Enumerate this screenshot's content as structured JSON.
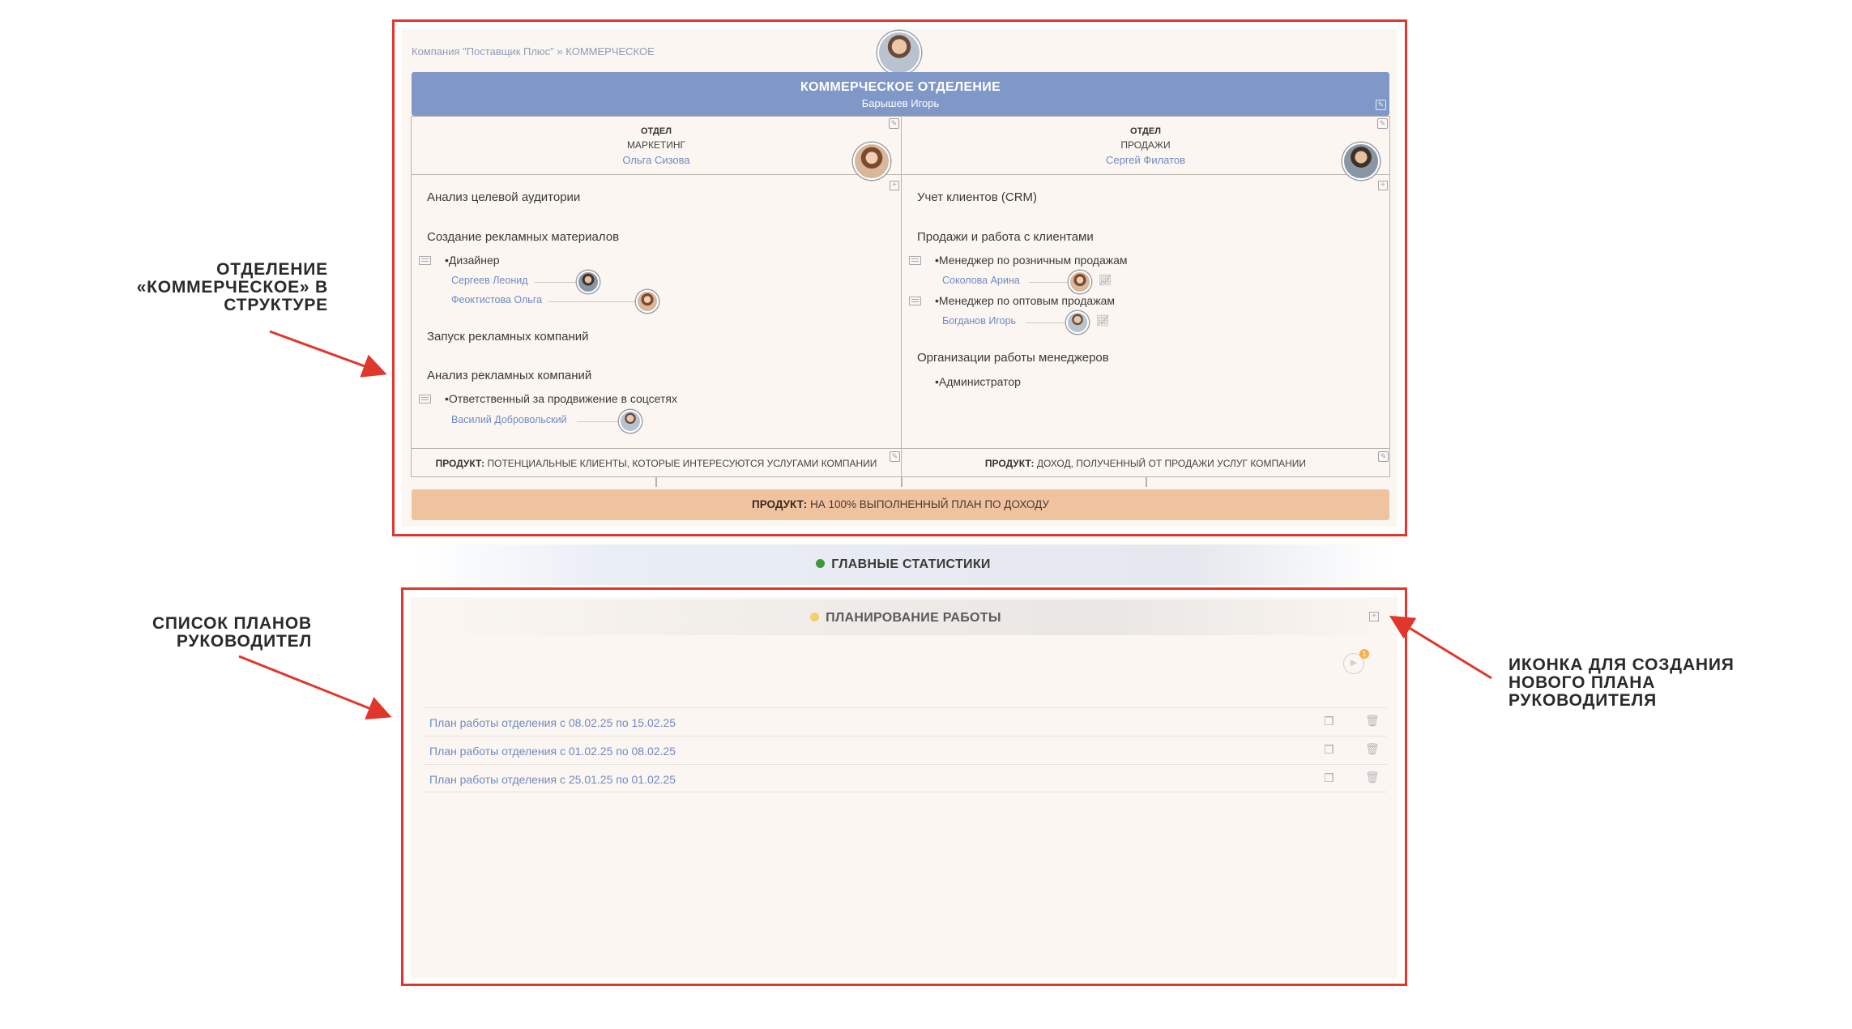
{
  "breadcrumb": {
    "company": "Компания \"Поставщик Плюс\"",
    "separator": "»",
    "current": "КОММЕРЧЕСКОЕ"
  },
  "division": {
    "title": "КОММЕРЧЕСКОЕ ОТДЕЛЕНИЕ",
    "head": "Барышев Игорь"
  },
  "departments": [
    {
      "type": "ОТДЕЛ",
      "name": "МАРКЕТИНГ",
      "head": "Ольга Сизова",
      "functions": [
        "Анализ целевой аудитории",
        "Создание рекламных материалов",
        "Запуск рекламных компаний",
        "Анализ рекламных компаний"
      ],
      "roles": [
        {
          "title": "Дизайнер",
          "people": [
            "Сергеев Леонид",
            "Феоктистова Ольга"
          ]
        },
        {
          "title": "Ответственный за продвижение в соцсетях",
          "people": [
            "Василий Добровольский"
          ]
        }
      ],
      "product_label": "ПРОДУКТ:",
      "product": "ПОТЕНЦИАЛЬНЫЕ КЛИЕНТЫ, КОТОРЫЕ ИНТЕРЕСУЮТСЯ УСЛУГАМИ КОМПАНИИ"
    },
    {
      "type": "ОТДЕЛ",
      "name": "ПРОДАЖИ",
      "head": "Сергей Филатов",
      "functions": [
        "Учет клиентов (CRM)",
        "Продажи и работа с клиентами",
        "Организации работы менеджеров"
      ],
      "roles": [
        {
          "title": "Менеджер по розничным продажам",
          "people": [
            "Соколова Арина"
          ]
        },
        {
          "title": "Менеджер по оптовым продажам",
          "people": [
            "Богданов Игорь"
          ]
        },
        {
          "title": "Администратор",
          "people": []
        }
      ],
      "product_label": "ПРОДУКТ:",
      "product": "ДОХОД, ПОЛУЧЕННЫЙ ОТ ПРОДАЖИ УСЛУГ КОМПАНИИ"
    }
  ],
  "division_product": {
    "label": "ПРОДУКТ:",
    "value": "НА 100% ВЫПОЛНЕННЫЙ ПЛАН ПО ДОХОДУ"
  },
  "stats": {
    "title": "ГЛАВНЫЕ СТАТИСТИКИ",
    "dot_color": "#3a9a3a"
  },
  "planning": {
    "title": "ПЛАНИРОВАНИЕ РАБОТЫ",
    "dot_color": "#f0d070",
    "badge": "1",
    "plans": [
      "План работы отделения с 08.02.25 по 15.02.25",
      "План работы отделения с 01.02.25 по 08.02.25",
      "План работы отделения с 25.01.25 по 01.02.25"
    ]
  },
  "annotations": {
    "structure": [
      "ОТДЕЛЕНИЕ",
      "«КОММЕРЧЕСКОЕ» В",
      "СТРУКТУРЕ"
    ],
    "plans_list": [
      "СПИСОК ПЛАНОВ",
      "РУКОВОДИТЕЛ"
    ],
    "new_plan_icon": [
      "ИКОНКА ДЛЯ СОЗДАНИЯ",
      "НОВОГО ПЛАНА",
      "РУКОВОДИТЕЛЯ"
    ]
  },
  "colors": {
    "highlight_frame": "#e0362c",
    "division_header": "#8098c8",
    "product_bar": "#efc2a0",
    "link": "#6f8ac4"
  },
  "icons": {
    "edit": "edit-icon",
    "add": "plus-square-icon",
    "role": "card-icon",
    "stats": "chart-icon",
    "copy": "copy-icon",
    "delete": "trash-icon",
    "play": "play-icon"
  }
}
